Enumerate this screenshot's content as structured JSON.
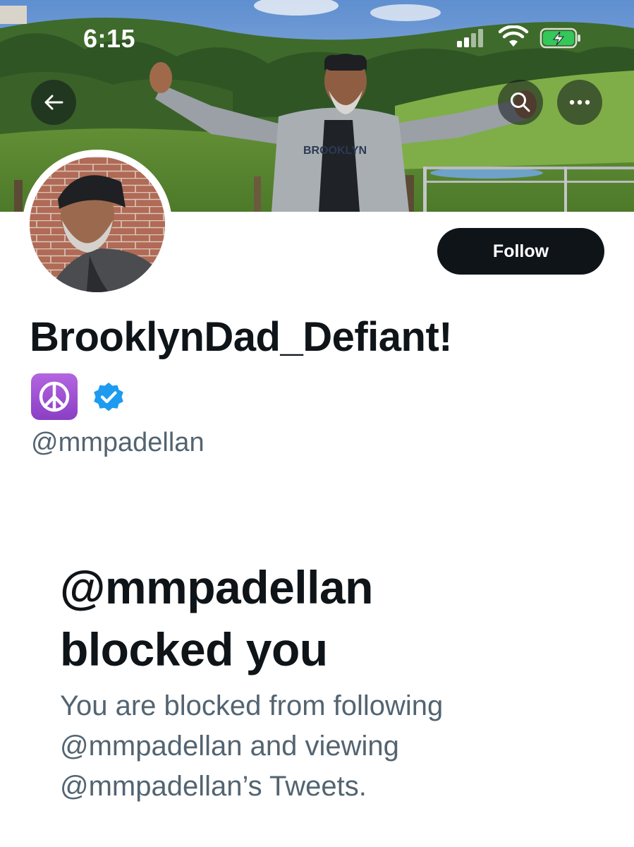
{
  "status_bar": {
    "time": "6:15",
    "icons": [
      "cellular-signal-icon",
      "wifi-icon",
      "battery-charging-icon"
    ]
  },
  "nav": {
    "back_icon": "arrow-left-icon",
    "search_icon": "search-icon",
    "more_icon": "more-horizontal-icon"
  },
  "banner": {
    "shirt_text": "BROOKLYN"
  },
  "profile": {
    "display_name": "BrooklynDad_Defiant!",
    "emoji_badge": "peace-symbol-icon",
    "verified_icon": "verified-badge-icon",
    "handle": "@mmpadellan",
    "follow_label": "Follow"
  },
  "blocked": {
    "title_line1": "@mmpadellan",
    "title_line2": "blocked you",
    "desc_line1": "You are blocked from following",
    "desc_line2": "@mmpadellan and viewing",
    "desc_line3": "@mmpadellan’s Tweets."
  },
  "colors": {
    "text_primary": "#0f1419",
    "text_secondary": "#536471",
    "verified_blue": "#1d9bf0",
    "follow_bg": "#0f1419",
    "emoji_purple": "#9b4fd0"
  }
}
